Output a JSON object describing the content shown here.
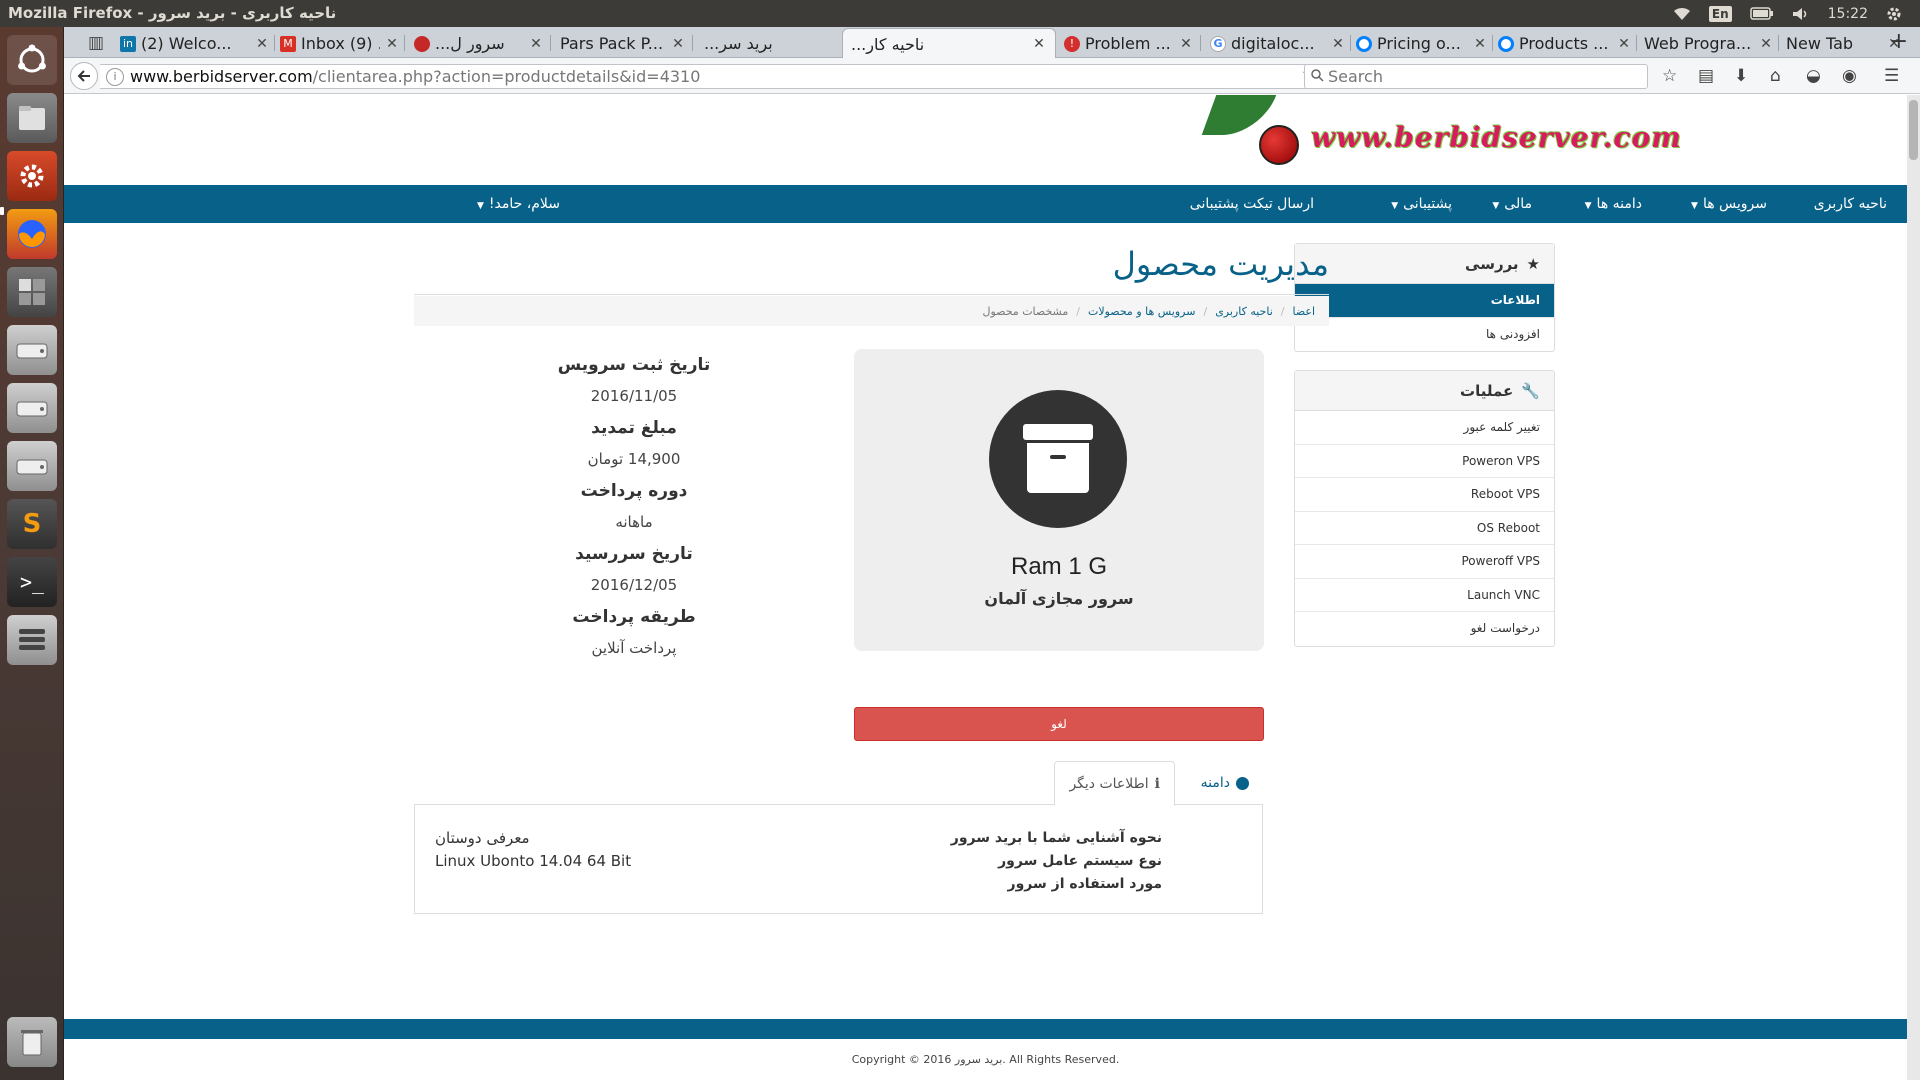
{
  "os_topbar": {
    "window_title": "Mozilla Firefox - ناحیه کاربری - برید سرور",
    "keyboard_layout": "En",
    "clock": "15:22",
    "icons": [
      "wifi-icon",
      "battery-icon",
      "volume-icon",
      "gear-icon"
    ]
  },
  "launcher": {
    "items": [
      {
        "name": "ubuntu-dash",
        "icon": "dash-icon"
      },
      {
        "name": "files",
        "icon": "files-icon"
      },
      {
        "name": "system-settings",
        "icon": "settings-icon"
      },
      {
        "name": "firefox",
        "icon": "firefox-icon"
      },
      {
        "name": "workspace-switcher",
        "icon": "workspace-icon"
      },
      {
        "name": "drive-1",
        "icon": "drive-icon"
      },
      {
        "name": "drive-2",
        "icon": "drive-icon"
      },
      {
        "name": "drive-3",
        "icon": "drive-icon"
      },
      {
        "name": "sublime-text",
        "icon": "sublime-icon",
        "glyph": "S"
      },
      {
        "name": "terminal",
        "icon": "terminal-icon",
        "glyph": ">_"
      },
      {
        "name": "stack",
        "icon": "stack-icon"
      },
      {
        "name": "trash",
        "icon": "trash-icon"
      }
    ]
  },
  "browser": {
    "tabs": [
      {
        "label": "(2) Welco...",
        "favicon": "linkedin-icon",
        "active": false
      },
      {
        "label": "Inbox (9) ...",
        "favicon": "gmail-icon",
        "active": false
      },
      {
        "label": "...سرور ل",
        "favicon": "berbid-icon",
        "active": false
      },
      {
        "label": "Pars Pack P...",
        "favicon": "none",
        "active": false
      },
      {
        "label": "...برید سر",
        "favicon": "none",
        "active": false
      },
      {
        "label": "...ناحیه کار",
        "favicon": "none",
        "active": true
      },
      {
        "label": "Problem ...",
        "favicon": "warning-icon",
        "active": false
      },
      {
        "label": "digitaloc...",
        "favicon": "google-icon",
        "active": false
      },
      {
        "label": "Pricing o...",
        "favicon": "digitalocean-icon",
        "active": false
      },
      {
        "label": "Products ...",
        "favicon": "digitalocean-icon",
        "active": false
      },
      {
        "label": "Web Progra...",
        "favicon": "none",
        "active": false
      },
      {
        "label": "New Tab",
        "favicon": "none",
        "active": false
      }
    ],
    "url_host": "www.berbidserver.com",
    "url_path": "/clientarea.php?action=productdetails&id=4310",
    "search_placeholder": "Search"
  },
  "site": {
    "logo_text": "www.berbidserver.com",
    "nav": {
      "client_area": "ناحیه کاربری",
      "services": "سرویس ها",
      "domains": "دامنه ها",
      "billing": "مالی",
      "support": "پشتیبانی",
      "open_ticket": "ارسال تیکت پشتیبانی",
      "greeting": "سلام، حامد!"
    },
    "sidebar": {
      "overview_title": "بررسی",
      "overview_items": [
        {
          "label": "اطلاعات",
          "active": true
        },
        {
          "label": "افزودنی ها",
          "active": false
        }
      ],
      "actions_title": "عملیات",
      "actions_items": [
        {
          "label": "تغییر کلمه عبور"
        },
        {
          "label": "Poweron VPS"
        },
        {
          "label": "Reboot VPS"
        },
        {
          "label": "OS Reboot"
        },
        {
          "label": "Poweroff VPS"
        },
        {
          "label": "Launch VNC"
        },
        {
          "label": "درخواست لغو"
        }
      ]
    },
    "page_title": "مدیریت محصول",
    "breadcrumb": {
      "home": "اعضا",
      "client_area": "ناحیه کاربری",
      "services": "سرویس ها و محصولات",
      "current": "مشخصات محصول"
    },
    "product": {
      "name": "Ram 1 G",
      "group": "سرور مجازی آلمان"
    },
    "details": [
      {
        "label": "تاریخ ثبت سرویس",
        "value": "2016/11/05"
      },
      {
        "label": "مبلغ تمدید",
        "value": "14,900 تومان"
      },
      {
        "label": "دوره پرداخت",
        "value": "ماهانه"
      },
      {
        "label": "تاریخ سررسید",
        "value": "2016/12/05"
      },
      {
        "label": "طریقه پرداخت",
        "value": "پرداخت آنلاین"
      }
    ],
    "cancel_button": "لغو",
    "tabs": {
      "domain": "دامنه",
      "other_info": "اطلاعات دیگر"
    },
    "other_info": {
      "labels": [
        "نحوه آشنایی شما با برید سرور",
        "نوع سیستم عامل سرور",
        "مورد استفاده از سرور"
      ],
      "values": [
        "معرفی دوستان",
        "Linux Ubonto 14.04 64 Bit",
        ""
      ]
    },
    "copyright": "Copyright © 2016 برید سرور. All Rights Reserved."
  }
}
